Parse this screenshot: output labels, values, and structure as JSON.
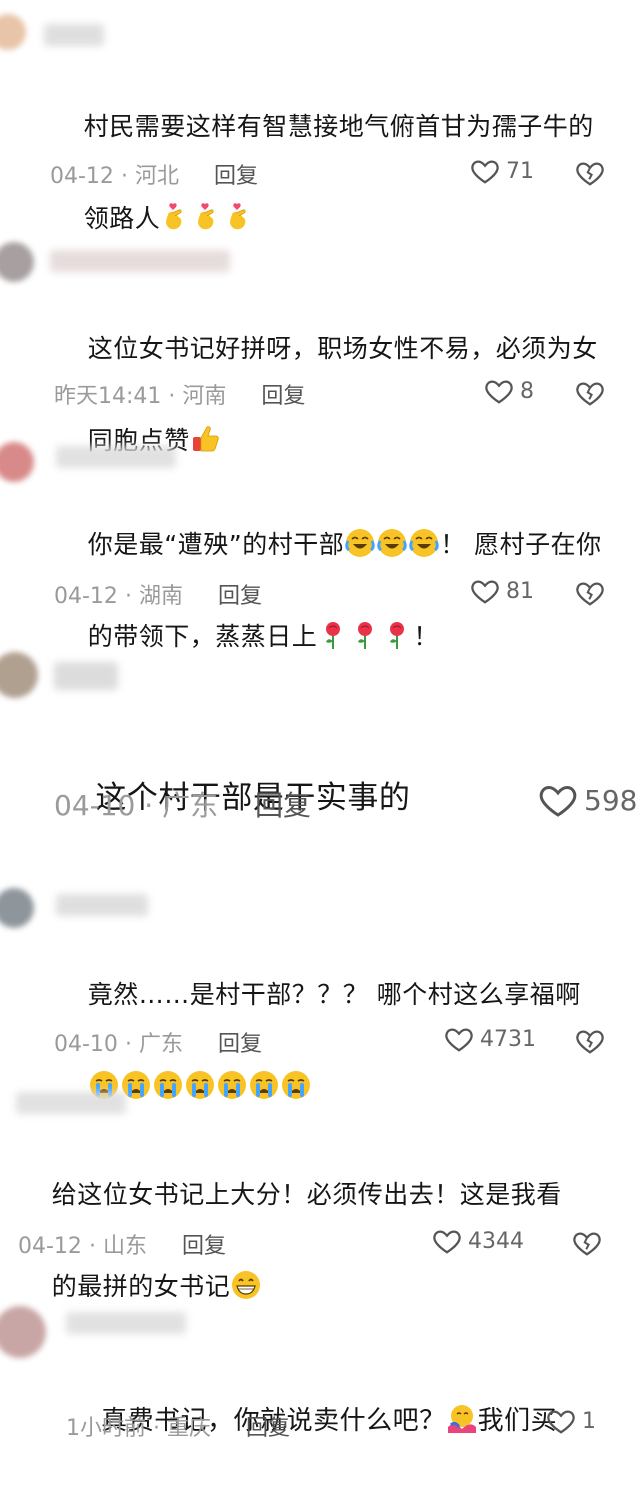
{
  "comments": [
    {
      "text_line1": "村民需要这样有智慧接地气俯首甘为孺子牛的",
      "text_line2": "领路人",
      "emojis": [
        "hand-heart-emoji",
        "hand-heart-emoji",
        "hand-heart-emoji"
      ],
      "date": "04-12",
      "location": "河北",
      "reply_label": "回复",
      "likes": "71"
    },
    {
      "text_line1": "这位女书记好拼呀，职场女性不易，必须为女",
      "text_line2": "同胞点赞",
      "emojis": [
        "thumbs-up-emoji"
      ],
      "date": "昨天14:41",
      "location": "河南",
      "reply_label": "回复",
      "likes": "8"
    },
    {
      "text_line1a": "你是最“遭殃”的村干部",
      "text_line1b": "！ 愿村子在你",
      "text_line2": "的带领下，蒸蒸日上",
      "text_line2_end": "！",
      "emojis": [
        "crying-laugh-emoji",
        "crying-laugh-emoji",
        "crying-laugh-emoji",
        "rose-emoji",
        "rose-emoji",
        "rose-emoji"
      ],
      "date": "04-12",
      "location": "湖南",
      "reply_label": "回复",
      "likes": "81"
    },
    {
      "text_line1": "这个村干部是干实事的",
      "date": "04-10",
      "location": "广东",
      "reply_label": "回复",
      "likes": "598"
    },
    {
      "text_line1": "竟然……是村干部？？？ 哪个村这么享福啊",
      "emojis": [
        "crying-emoji",
        "crying-emoji",
        "crying-emoji",
        "crying-emoji",
        "crying-emoji",
        "crying-emoji",
        "crying-emoji"
      ],
      "date": "04-10",
      "location": "广东",
      "reply_label": "回复",
      "likes": "4731"
    },
    {
      "text_line1": "给这位女书记上大分！必须传出去！这是我看",
      "text_line2": "的最拼的女书记",
      "emojis": [
        "grin-emoji"
      ],
      "date": "04-12",
      "location": "山东",
      "reply_label": "回复",
      "likes": "4344"
    },
    {
      "text_line1a": "真费书记，你就说卖什么吧？",
      "text_line1b": "我们买",
      "emojis": [
        "hug-emoji"
      ],
      "date": "1小时前",
      "location": "重庆",
      "reply_label": "回复",
      "likes": "1"
    }
  ],
  "separator": "·"
}
